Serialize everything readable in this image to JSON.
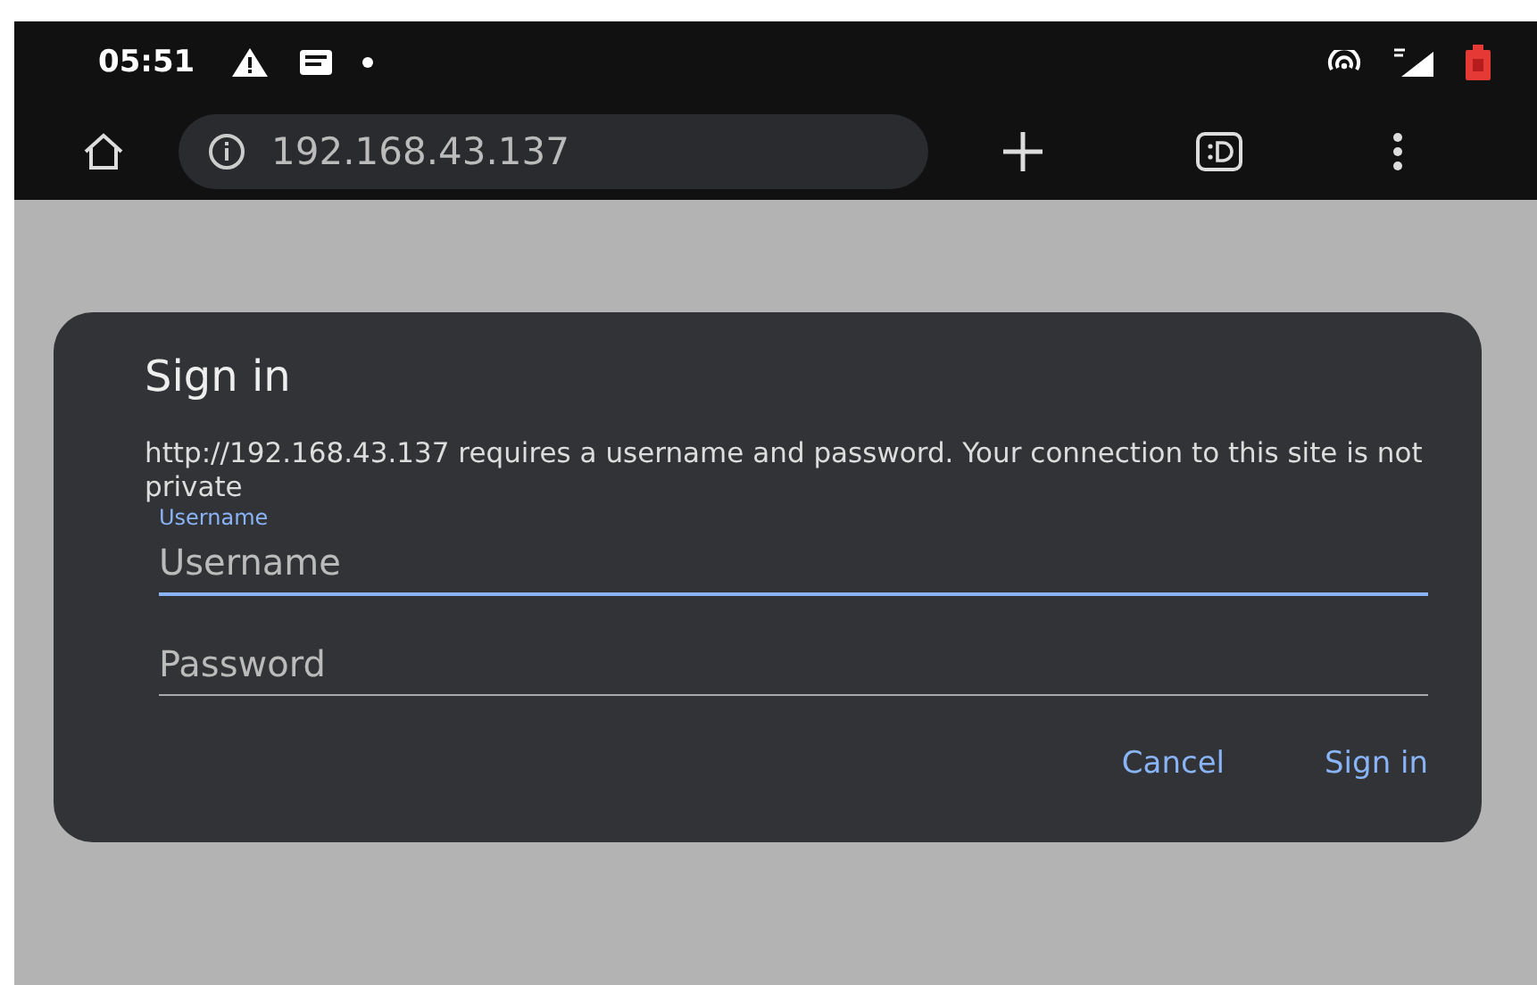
{
  "status_bar": {
    "time": "05:51"
  },
  "address_bar": {
    "url": "192.168.43.137"
  },
  "dialog": {
    "title": "Sign in",
    "message": "http://192.168.43.137 requires a username and password. Your connection to this site is not private",
    "fields": [
      {
        "label": "Username",
        "placeholder": "Username",
        "focused": true
      },
      {
        "placeholder": "Password",
        "focused": false
      }
    ],
    "buttons": [
      "Cancel",
      "Sign in"
    ]
  }
}
